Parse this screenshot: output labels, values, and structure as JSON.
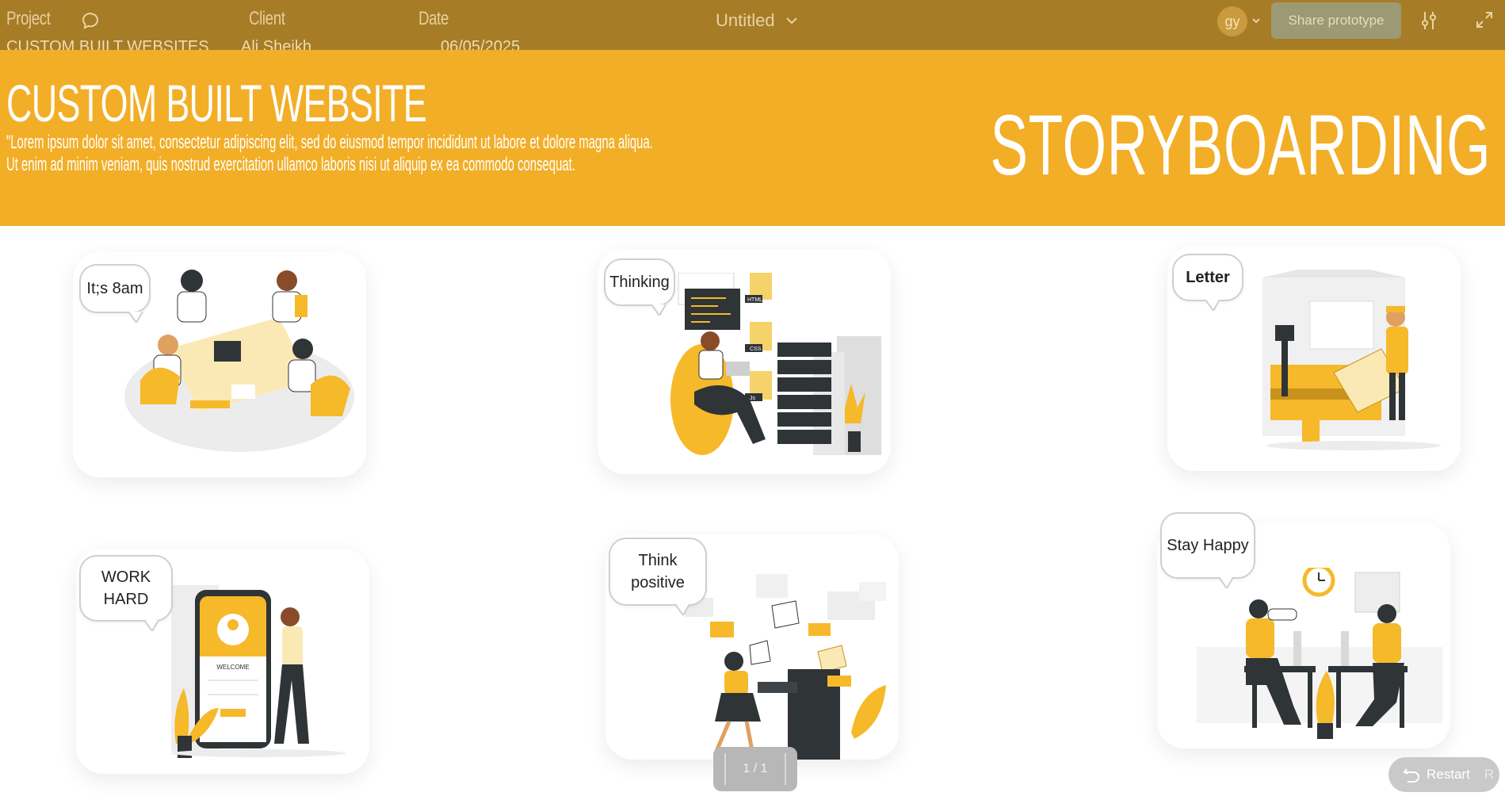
{
  "header": {
    "project_label": "Project",
    "client_label": "Client",
    "date_label": "Date",
    "project_value": "CUSTOM  BUILT WEBSITES",
    "client_value": "Ali Sheikh",
    "date_value": "06/05/2025",
    "file_title": "Untitled",
    "avatar_initials": "gy",
    "share_label": "Share prototype"
  },
  "banner": {
    "title": "CUSTOM BUILT WEBSITE",
    "description_line1": "\"Lorem ipsum dolor sit amet, consectetur adipiscing elit, sed do eiusmod tempor incididunt ut labore et dolore magna aliqua.",
    "description_line2": " Ut enim ad minim veniam, quis nostrud exercitation ullamco laboris nisi ut aliquip ex ea commodo consequat.",
    "storyboard_title": "STORYBOARDING"
  },
  "frames": [
    {
      "bubble": "It;s 8am"
    },
    {
      "bubble": "Thinking"
    },
    {
      "bubble": "Letter"
    },
    {
      "bubble": "WORK\nHARD"
    },
    {
      "bubble": "Think\npositive"
    },
    {
      "bubble": "Stay Happy"
    }
  ],
  "phone": {
    "welcome": "WELCOME"
  },
  "file_tags": [
    "HTML",
    "CSS",
    "Js"
  ],
  "footer": {
    "pager": "1 / 1",
    "restart_label": "Restart",
    "restart_key": "R"
  },
  "colors": {
    "topbar": "#a67c27",
    "banner": "#f2ae27",
    "accent": "#f5b92a",
    "dark": "#2f3437"
  },
  "icons": [
    "chat-icon",
    "chevron-down-icon",
    "settings-sliders-icon",
    "expand-icon",
    "restart-icon"
  ]
}
